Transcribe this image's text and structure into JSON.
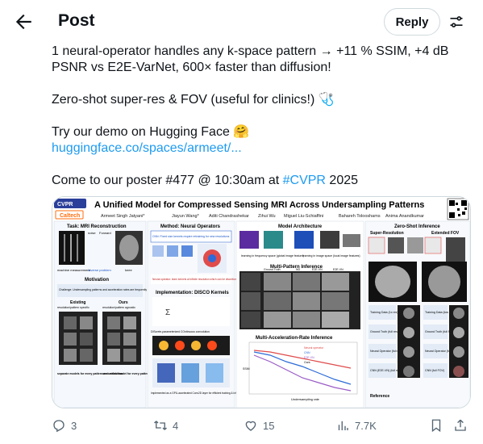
{
  "header": {
    "title": "Post",
    "reply_label": "Reply"
  },
  "tweet": {
    "line1": "1 neural-operator handles any k-space pattern → +11 % SSIM, +4 dB PSNR vs E2E-VarNet, 600× faster than diffusion!",
    "line2": "Zero-shot super-res & FOV (useful for clinics!)",
    "line2_emoji": "🩺",
    "line3": "Try our demo on Hugging Face",
    "line3_emoji": "🤗",
    "demo_link": "huggingface.co/spaces/armeet/...",
    "line4_prefix": "Come to our poster #477 @ 10:30am at ",
    "hashtag": "#CVPR",
    "line4_suffix": " 2025"
  },
  "poster": {
    "logo": "CVPR",
    "institution": "Caltech",
    "title": "A Unified Model for Compressed Sensing MRI Across Undersampling Patterns",
    "authors": [
      "Armeet Singh Jatyani*",
      "Jiayun Wang*",
      "Aditi Chandrashekar",
      "Zihui Wu",
      "Miguel Liu-Schiaffini",
      "Bahareh Tolooshams",
      "Anima Anandkumar"
    ],
    "col1_title": "Task: MRI Reconstruction",
    "col1_labels": [
      "noise",
      "Forward",
      "machine measurement",
      "Inverse problem",
      "knee"
    ],
    "motivation_title": "Motivation",
    "motivation_text": "Challenge: Undersampling patterns and acceleration rates are frequently changed in clinics (for different purposes)",
    "existing_label": "Existing",
    "ours_label": "Ours",
    "existing_sub": "resolution/pattern specific",
    "ours_sub": "resolution/pattern agnostic",
    "existing_foot": "separate models for every pattern and resolution",
    "ours_foot": "one unified model for every pattern and resolution",
    "col2_title": "Method: Neural Operators",
    "col2_note": "CNN: Fixed size kernels require retraining for new resolutions",
    "col2_note2": "Neural operator: learn kernels at infinite resolution which can be discretized at any size. Learn once, infer at any resolution.",
    "disco_title": "Implementation: DISCO Kernels",
    "disco_caption": "DIScrete-parameterized COntinuous convolution",
    "disco_foot": "Implemented as a GPU-accelerated Conv2D layer for efficient training & inference.",
    "col3_title": "Model Architecture",
    "arch_caption1": "learning in frequency space (global image feature)",
    "arch_caption2": "learning in image space (local image features)",
    "multi_title": "Multi-Pattern Inference",
    "multi_cols": [
      "Ground Truth",
      "NO",
      "E2E-VN",
      "E2E-VN"
    ],
    "multi_accel_title": "Multi-Acceleration-Rate Inference",
    "legend": [
      "Neural operator",
      "CNN",
      "E2E-VN",
      "Ours"
    ],
    "xlabel": "Undersampling rate",
    "ylabel": "SSIM",
    "col4_title": "Zero-Shot Inference",
    "super_res": "Super-Resolution",
    "ext_fov": "Extended FOV",
    "fov_labels": [
      "Training Data (1x res)",
      "Ground Truth (full res)",
      "Neural Operator (full res)",
      "CNN (E2E-VN) (full res)"
    ],
    "fov_labels2": [
      "Training Data (low FOV*)",
      "Ground Truth (full FOV)",
      "Neural Operator (full FOV)",
      "CNN (full FOV)"
    ],
    "reference": "Reference"
  },
  "actions": {
    "replies": "3",
    "reposts": "4",
    "likes": "15",
    "views": "7.7K"
  },
  "colors": {
    "link": "#1d9bf0",
    "muted": "#536471",
    "border": "#cfd9de"
  }
}
